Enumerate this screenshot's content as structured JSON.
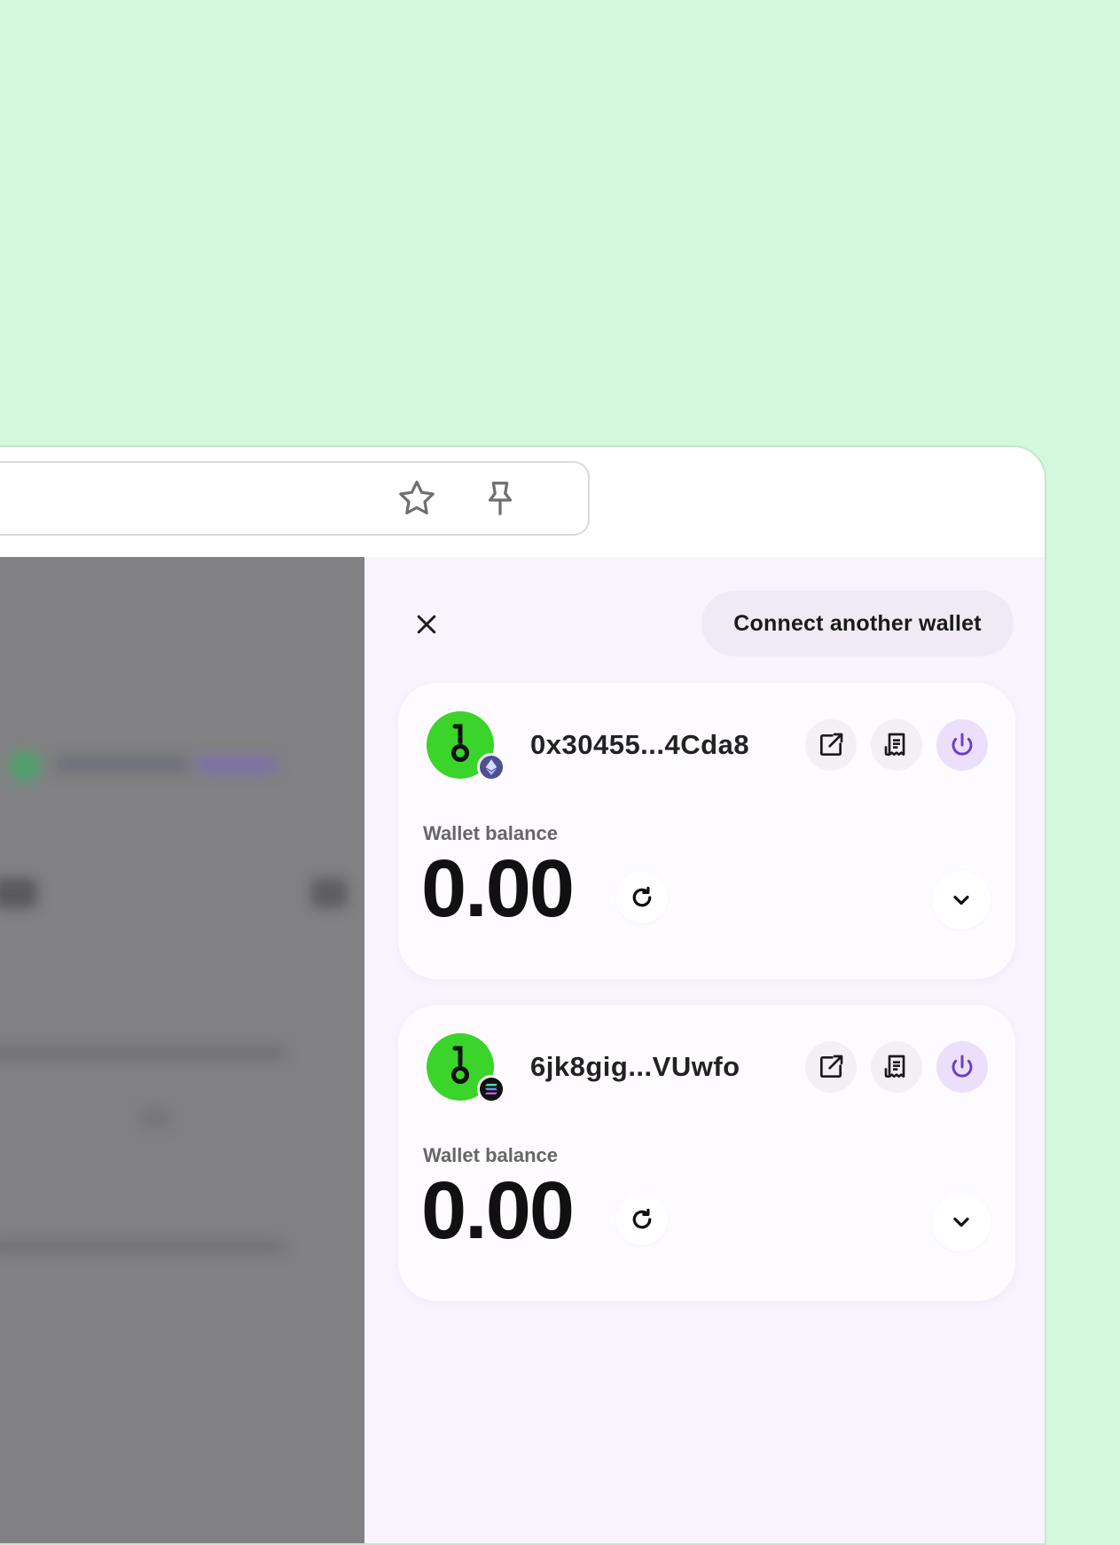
{
  "panel": {
    "connect_label": "Connect another wallet"
  },
  "wallets": [
    {
      "address": "0x30455...4Cda8",
      "chain_icon": "ethereum-icon",
      "chain_color": "#4d4f92",
      "balance_label": "Wallet balance",
      "balance": "0.00"
    },
    {
      "address": "6jk8gig...VUwfo",
      "chain_icon": "solana-icon",
      "chain_color": "#111111",
      "balance_label": "Wallet balance",
      "balance": "0.00"
    }
  ],
  "colors": {
    "background": "#d4f8db",
    "avatar": "#3ad42a",
    "panel": "#f8f3fd",
    "power_accent": "#6b3cc9"
  }
}
